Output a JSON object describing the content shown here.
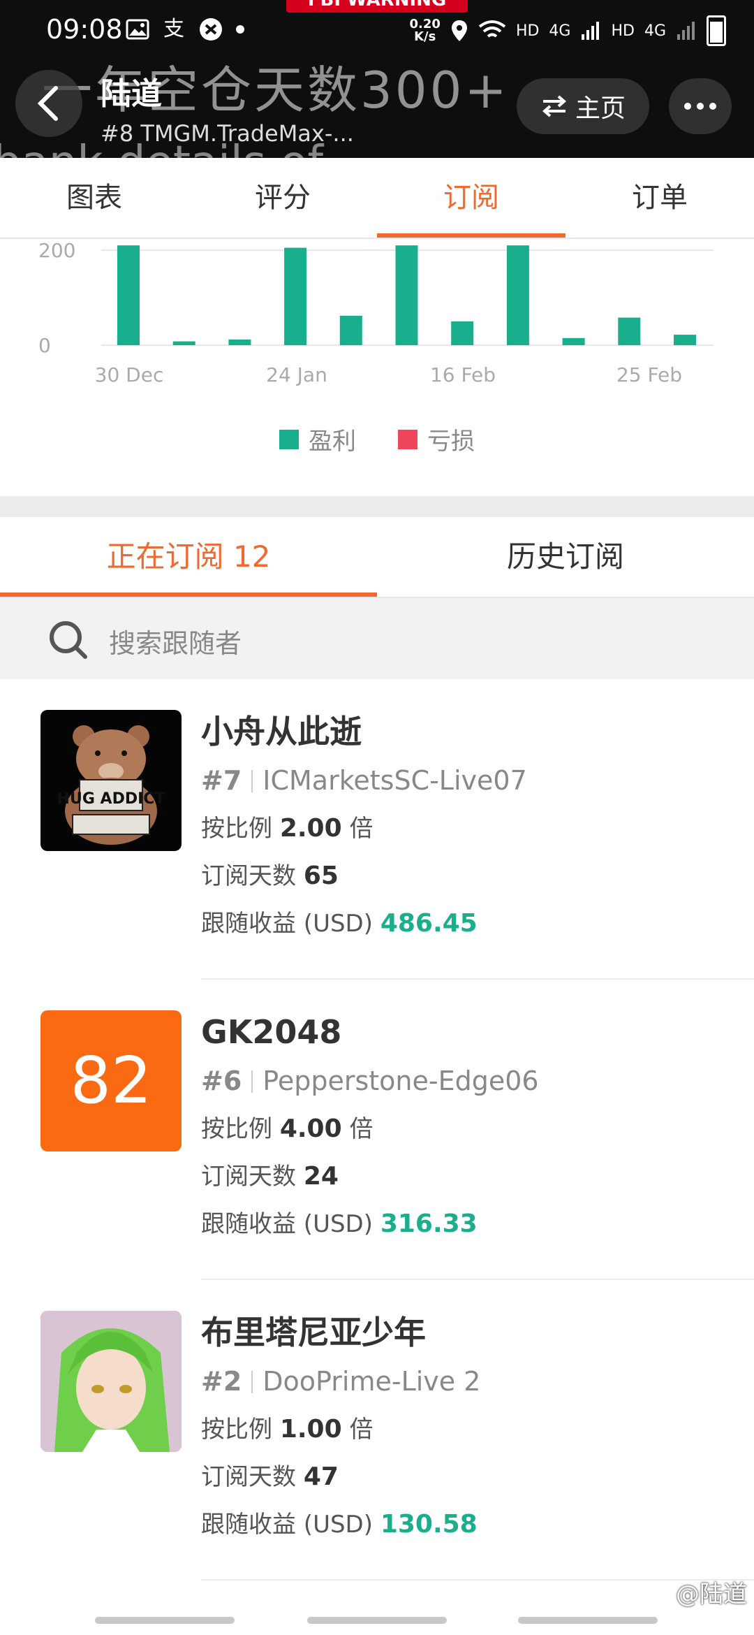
{
  "status_bar": {
    "time": "09:08",
    "net_speed": "0.20\nK/s",
    "hd1": "HD",
    "net1": "4G",
    "hd2": "HD",
    "net2": "4G"
  },
  "banner": {
    "fbi": "FBI WARNING",
    "text": "一年空仓天数300+",
    "text2": "bank details of"
  },
  "header": {
    "title": "陆道",
    "subtitle": "#8  TMGM.TradeMax-...",
    "home_label": "主页"
  },
  "tabs": [
    {
      "label": "图表",
      "active": false
    },
    {
      "label": "评分",
      "active": false
    },
    {
      "label": "订阅",
      "active": true
    },
    {
      "label": "订单",
      "active": false
    }
  ],
  "chart_data": {
    "type": "bar",
    "y_ticks": [
      "200",
      "0"
    ],
    "ylim": [
      0,
      200
    ],
    "x_tick_labels": [
      "30 Dec",
      "24 Jan",
      "16 Feb",
      "25 Feb"
    ],
    "series": [
      {
        "name": "盈利",
        "color": "#1aaf8c",
        "values": [
          220,
          8,
          12,
          205,
          62,
          218,
          50,
          218,
          15,
          58,
          22
        ]
      },
      {
        "name": "亏损",
        "color": "#f0465b",
        "values": [
          0,
          0,
          0,
          0,
          0,
          0,
          0,
          0,
          0,
          0,
          0
        ]
      }
    ],
    "legend": [
      "盈利",
      "亏损"
    ]
  },
  "sub_tabs": [
    {
      "label": "正在订阅 12",
      "active": true
    },
    {
      "label": "历史订阅",
      "active": false
    }
  ],
  "search": {
    "placeholder": "搜索跟随者"
  },
  "subscribers": [
    {
      "name": "小舟从此逝",
      "rank": "#7",
      "server": "ICMarketsSC-Live07",
      "ratio_label": "按比例",
      "ratio": "2.00",
      "ratio_unit": "倍",
      "days_label": "订阅天数",
      "days": "65",
      "profit_label": "跟随收益 (USD)",
      "profit": "486.45",
      "avatar_text": "HUG ADDICT"
    },
    {
      "name": "GK2048",
      "rank": "#6",
      "server": "Pepperstone-Edge06",
      "ratio_label": "按比例",
      "ratio": "4.00",
      "ratio_unit": "倍",
      "days_label": "订阅天数",
      "days": "24",
      "profit_label": "跟随收益 (USD)",
      "profit": "316.33",
      "avatar_text": "82"
    },
    {
      "name": "布里塔尼亚少年",
      "rank": "#2",
      "server": "DooPrime-Live 2",
      "ratio_label": "按比例",
      "ratio": "1.00",
      "ratio_unit": "倍",
      "days_label": "订阅天数",
      "days": "47",
      "profit_label": "跟随收益 (USD)",
      "profit": "130.58"
    }
  ],
  "watermark": "@陆道"
}
